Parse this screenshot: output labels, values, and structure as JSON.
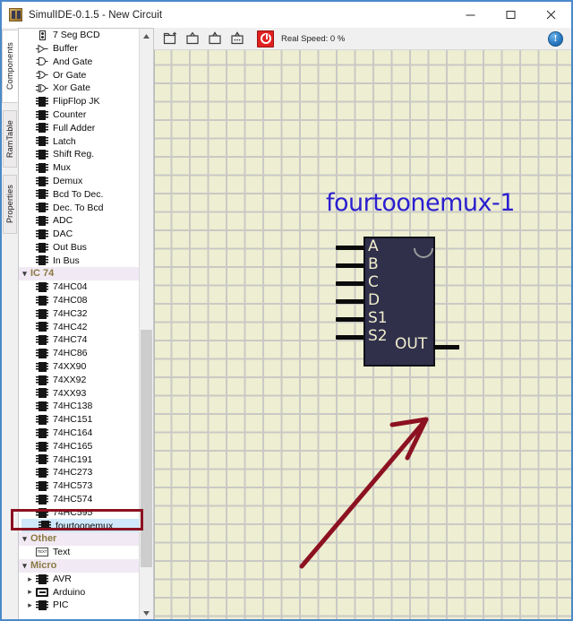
{
  "window": {
    "title": "SimulIDE-0.1.5  -  New Circuit",
    "icon": "simulide-app-icon",
    "controls": {
      "minimize": "minimize-icon",
      "maximize": "maximize-icon",
      "close": "close-icon"
    }
  },
  "left_tabs": [
    {
      "label": "Components",
      "active": true
    },
    {
      "label": "RamTable",
      "active": false
    },
    {
      "label": "Properties",
      "active": false
    }
  ],
  "toolbar": {
    "buttons": [
      {
        "name": "new-circuit-button",
        "icon": "new-file-icon"
      },
      {
        "name": "open-circuit-button",
        "icon": "open-folder-icon"
      },
      {
        "name": "save-circuit-button",
        "icon": "save-icon"
      },
      {
        "name": "save-as-button",
        "icon": "save-as-icon"
      }
    ],
    "power_button": {
      "name": "power-button",
      "icon": "power-icon"
    },
    "speed_label": "Real Speed: 0 %",
    "info_icon": "info-icon",
    "info_glyph": "!"
  },
  "tree": {
    "items": [
      {
        "label": "7 Seg BCD",
        "icon": "seven-seg-icon",
        "indent": 1,
        "type": "item"
      },
      {
        "label": "Buffer",
        "icon": "buffer-gate-icon",
        "indent": 1,
        "type": "item"
      },
      {
        "label": "And Gate",
        "icon": "and-gate-icon",
        "indent": 1,
        "type": "item"
      },
      {
        "label": "Or Gate",
        "icon": "or-gate-icon",
        "indent": 1,
        "type": "item"
      },
      {
        "label": "Xor Gate",
        "icon": "xor-gate-icon",
        "indent": 1,
        "type": "item"
      },
      {
        "label": "FlipFlop JK",
        "icon": "chip-icon",
        "indent": 1,
        "type": "item"
      },
      {
        "label": "Counter",
        "icon": "chip-icon",
        "indent": 1,
        "type": "item"
      },
      {
        "label": "Full Adder",
        "icon": "chip-icon",
        "indent": 1,
        "type": "item"
      },
      {
        "label": "Latch",
        "icon": "chip-icon",
        "indent": 1,
        "type": "item"
      },
      {
        "label": "Shift Reg.",
        "icon": "chip-icon",
        "indent": 1,
        "type": "item"
      },
      {
        "label": "Mux",
        "icon": "chip-icon",
        "indent": 1,
        "type": "item"
      },
      {
        "label": "Demux",
        "icon": "chip-icon",
        "indent": 1,
        "type": "item"
      },
      {
        "label": "Bcd To Dec.",
        "icon": "chip-icon",
        "indent": 1,
        "type": "item"
      },
      {
        "label": "Dec. To Bcd",
        "icon": "chip-icon",
        "indent": 1,
        "type": "item"
      },
      {
        "label": "ADC",
        "icon": "chip-icon",
        "indent": 1,
        "type": "item"
      },
      {
        "label": "DAC",
        "icon": "chip-icon",
        "indent": 1,
        "type": "item"
      },
      {
        "label": "Out Bus",
        "icon": "chip-icon",
        "indent": 1,
        "type": "item"
      },
      {
        "label": "In Bus",
        "icon": "chip-icon",
        "indent": 1,
        "type": "item"
      },
      {
        "label": "IC 74",
        "icon": "chevron-down-icon",
        "indent": 0,
        "type": "category",
        "expanded": true
      },
      {
        "label": "74HC04",
        "icon": "dip-chip-icon",
        "indent": 1,
        "type": "item"
      },
      {
        "label": "74HC08",
        "icon": "dip-chip-icon",
        "indent": 1,
        "type": "item"
      },
      {
        "label": "74HC32",
        "icon": "dip-chip-icon",
        "indent": 1,
        "type": "item"
      },
      {
        "label": "74HC42",
        "icon": "dip-chip-icon",
        "indent": 1,
        "type": "item"
      },
      {
        "label": "74HC74",
        "icon": "dip-chip-icon",
        "indent": 1,
        "type": "item"
      },
      {
        "label": "74HC86",
        "icon": "dip-chip-icon",
        "indent": 1,
        "type": "item"
      },
      {
        "label": "74XX90",
        "icon": "dip-chip-icon",
        "indent": 1,
        "type": "item"
      },
      {
        "label": "74XX92",
        "icon": "dip-chip-icon",
        "indent": 1,
        "type": "item"
      },
      {
        "label": "74XX93",
        "icon": "dip-chip-icon",
        "indent": 1,
        "type": "item"
      },
      {
        "label": "74HC138",
        "icon": "dip-chip-icon",
        "indent": 1,
        "type": "item"
      },
      {
        "label": "74HC151",
        "icon": "dip-chip-icon",
        "indent": 1,
        "type": "item"
      },
      {
        "label": "74HC164",
        "icon": "dip-chip-icon",
        "indent": 1,
        "type": "item"
      },
      {
        "label": "74HC165",
        "icon": "dip-chip-icon",
        "indent": 1,
        "type": "item"
      },
      {
        "label": "74HC191",
        "icon": "dip-chip-icon",
        "indent": 1,
        "type": "item"
      },
      {
        "label": "74HC273",
        "icon": "dip-chip-icon",
        "indent": 1,
        "type": "item"
      },
      {
        "label": "74HC573",
        "icon": "dip-chip-icon",
        "indent": 1,
        "type": "item"
      },
      {
        "label": "74HC574",
        "icon": "dip-chip-icon",
        "indent": 1,
        "type": "item"
      },
      {
        "label": "74HC595",
        "icon": "dip-chip-icon",
        "indent": 1,
        "type": "item"
      },
      {
        "label": "fourtoonemux",
        "icon": "dip-chip-icon",
        "indent": 1,
        "type": "item",
        "selected": true
      },
      {
        "label": "Other",
        "icon": "chevron-down-icon",
        "indent": 0,
        "type": "category",
        "expanded": true
      },
      {
        "label": "Text",
        "icon": "text-icon",
        "indent": 1,
        "type": "item"
      },
      {
        "label": "Micro",
        "icon": "chevron-down-icon",
        "indent": 0,
        "type": "category",
        "expanded": true
      },
      {
        "label": "AVR",
        "icon": "dip-chip-icon",
        "indent": 1,
        "type": "item",
        "collapsed_child": true
      },
      {
        "label": "Arduino",
        "icon": "arduino-icon",
        "indent": 1,
        "type": "item",
        "collapsed_child": true
      },
      {
        "label": "PIC",
        "icon": "dip-chip-icon",
        "indent": 1,
        "type": "item",
        "collapsed_child": true
      }
    ],
    "scrollbar": {
      "up_arrow": "scroll-up-icon",
      "down_arrow": "scroll-down-icon"
    }
  },
  "canvas": {
    "background_color": "#eeeed2",
    "grid_color": "#c3c3c3",
    "component": {
      "label": "fourtoonemux-1",
      "label_color": "#2a1fd0",
      "body_color": "#30304b",
      "pin_label_color": "#f2eece",
      "input_pins": [
        "A",
        "B",
        "C",
        "D",
        "S1",
        "S2"
      ],
      "output_pins": [
        "OUT"
      ]
    },
    "annotations": {
      "color": "#8c1121",
      "rect_target": "fourtoonemux",
      "arrow": "arrow-pointing-to-component"
    }
  }
}
